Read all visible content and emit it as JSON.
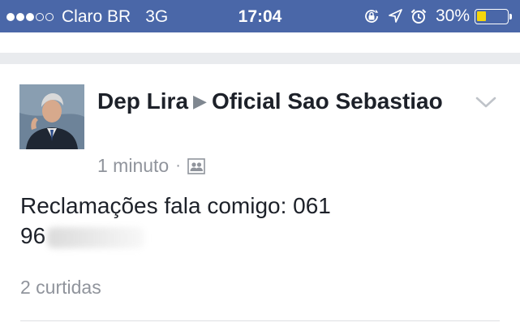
{
  "status_bar": {
    "signal_strength": "3 of 5",
    "carrier": "Claro BR",
    "network": "3G",
    "time": "17:04",
    "battery_percent": "30%",
    "battery_level": 0.3,
    "icons": [
      "orientation-lock-icon",
      "location-arrow-icon",
      "alarm-icon",
      "battery-icon"
    ]
  },
  "post": {
    "author": "Dep Lira",
    "group": "Oficial Sao Sebastiao",
    "timestamp": "1 minuto",
    "audience_icon": "group-audience-icon",
    "text": "Reclamações fala comigo: 061",
    "text_line2": "96",
    "likes": "2 curtidas"
  }
}
